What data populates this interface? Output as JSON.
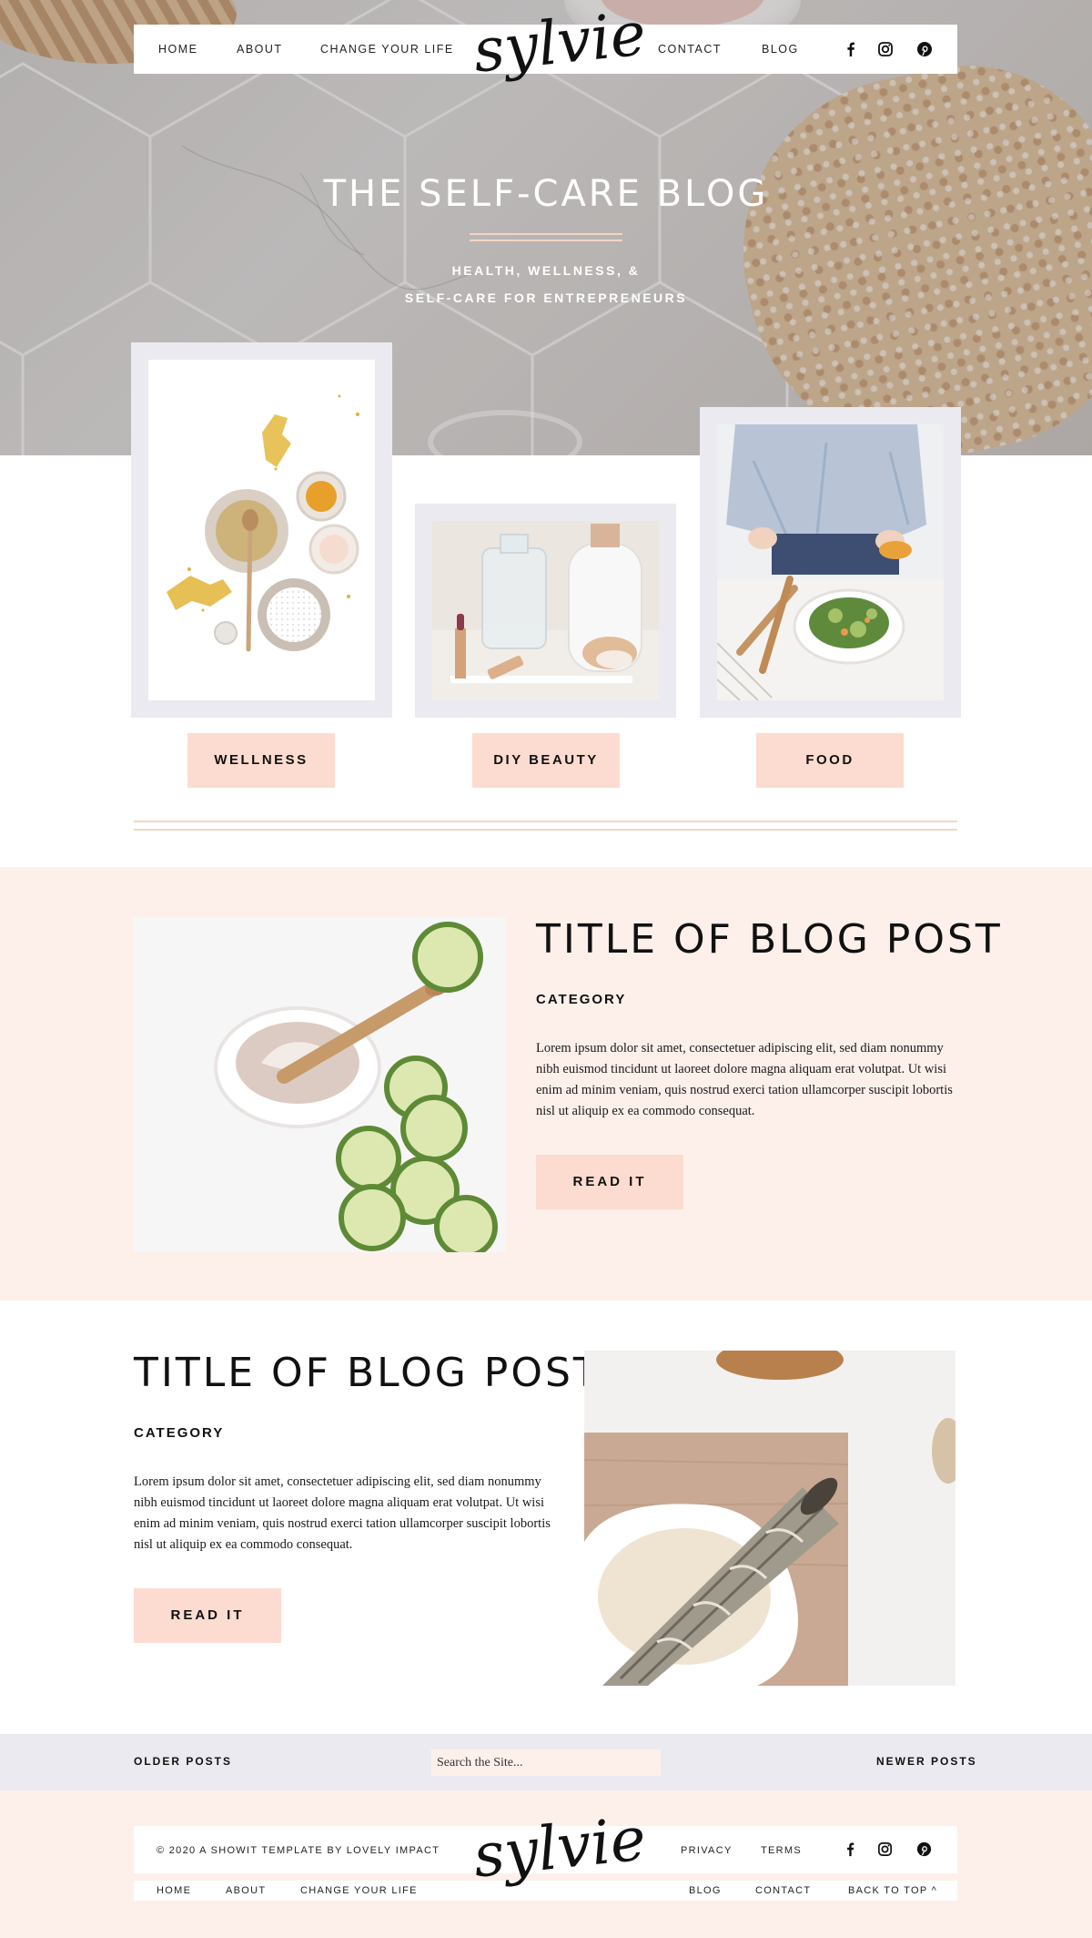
{
  "nav": {
    "left": [
      "HOME",
      "ABOUT",
      "CHANGE YOUR LIFE"
    ],
    "right": [
      "CONTACT",
      "BLOG"
    ],
    "logo": "sylvie",
    "social": [
      "facebook-icon",
      "instagram-icon",
      "pinterest-icon"
    ]
  },
  "hero": {
    "title": "THE SELF-CARE BLOG",
    "subtitle_line1": "HEALTH, WELLNESS, &",
    "subtitle_line2": "SELF-CARE FOR ENTREPRENEURS"
  },
  "categories": [
    {
      "label": "WELLNESS"
    },
    {
      "label": "DIY BEAUTY"
    },
    {
      "label": "FOOD"
    }
  ],
  "posts": [
    {
      "title": "TITLE OF BLOG POST",
      "category": "CATEGORY",
      "excerpt": "Lorem ipsum dolor sit amet, consectetuer adipiscing elit, sed diam nonummy nibh euismod tincidunt ut laoreet dolore magna aliquam erat volutpat. Ut wisi enim ad minim veniam, quis nostrud exerci tation ullamcorper suscipit lobortis nisl ut aliquip ex ea commodo consequat.",
      "button": "READ IT"
    },
    {
      "title": "TITLE OF BLOG POST",
      "category": "CATEGORY",
      "excerpt": "Lorem ipsum dolor sit amet, consectetuer adipiscing elit, sed diam nonummy nibh euismod tincidunt ut laoreet dolore magna aliquam erat volutpat. Ut wisi enim ad minim veniam, quis nostrud exerci tation ullamcorper suscipit lobortis nisl ut aliquip ex ea commodo consequat.",
      "button": "READ IT"
    }
  ],
  "pager": {
    "older": "OLDER POSTS",
    "newer": "NEWER POSTS",
    "search_placeholder": "Search the Site..."
  },
  "footer": {
    "copyright": "© 2020 A SHOWIT TEMPLATE BY LOVELY IMPACT",
    "logo": "sylvie",
    "links_top": [
      "PRIVACY",
      "TERMS"
    ],
    "links_left": [
      "HOME",
      "ABOUT",
      "CHANGE YOUR LIFE"
    ],
    "links_right": [
      "BLOG",
      "CONTACT",
      "BACK TO TOP ^"
    ]
  },
  "colors": {
    "accent_pink": "#fcdcd0",
    "blush_band": "#fdf0eb",
    "frame_lavender": "#ebeaf0"
  }
}
